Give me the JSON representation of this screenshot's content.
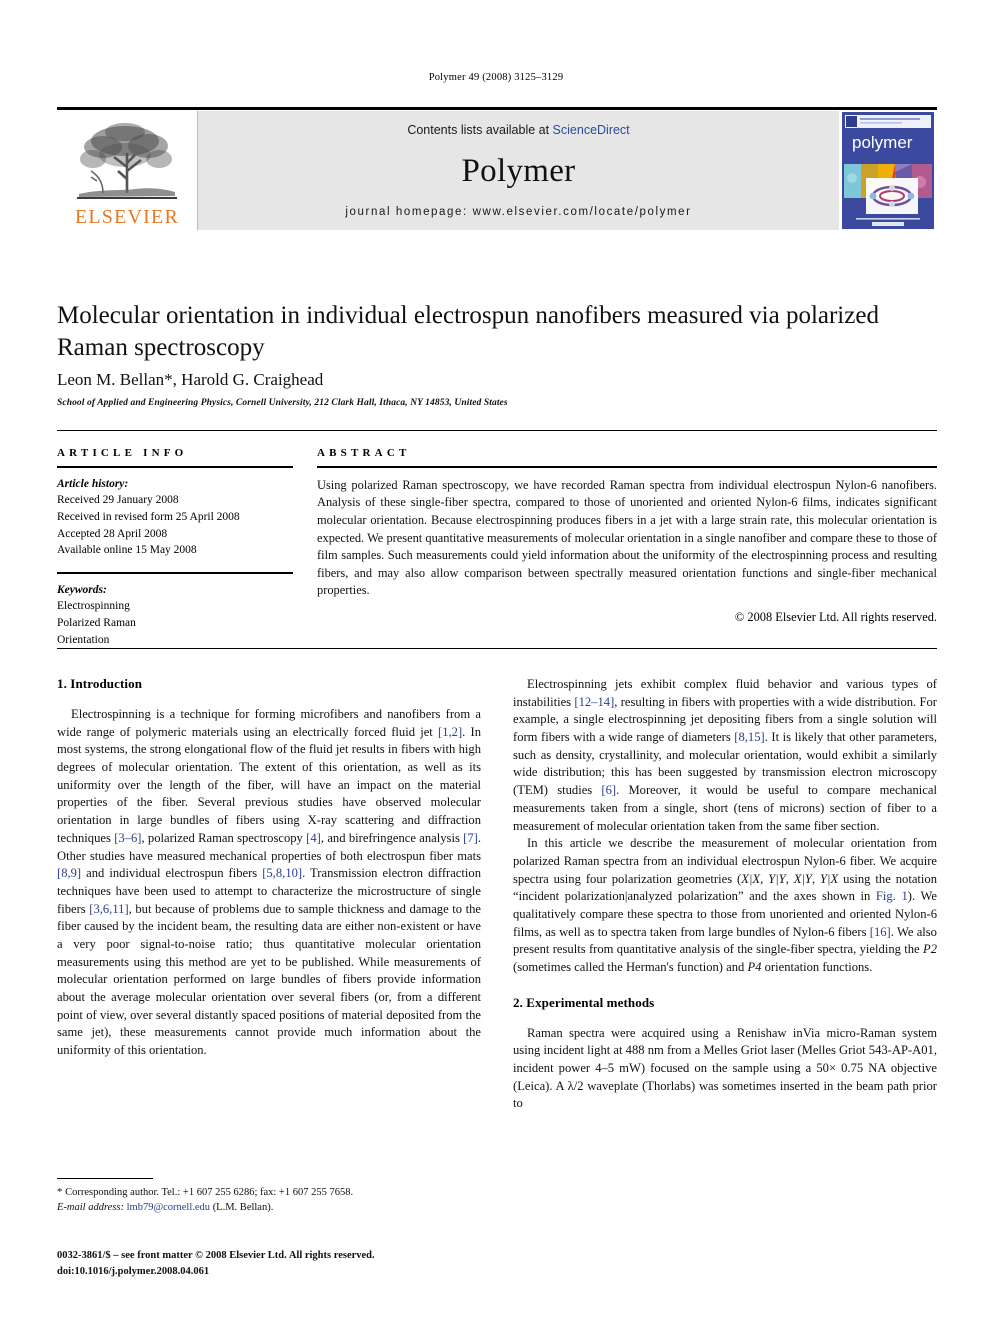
{
  "running_head": "Polymer 49 (2008) 3125–3129",
  "masthead": {
    "contents_prefix": "Contents lists available at ",
    "sciencedirect": "ScienceDirect",
    "journal_name": "Polymer",
    "homepage": "journal homepage: www.elsevier.com/locate/polymer",
    "publisher": "ELSEVIER",
    "cover_title": "polymer",
    "accent_color": "#E87722",
    "link_color": "#2b4b9b",
    "cover_bg": "#3b4a9e"
  },
  "article": {
    "title": "Molecular orientation in individual electrospun nanofibers measured via polarized Raman spectroscopy",
    "authors": "Leon M. Bellan*, Harold G. Craighead",
    "affiliation": "School of Applied and Engineering Physics, Cornell University, 212 Clark Hall, Ithaca, NY 14853, United States"
  },
  "info": {
    "label": "ARTICLE INFO",
    "history_head": "Article history:",
    "history": [
      "Received 29 January 2008",
      "Received in revised form 25 April 2008",
      "Accepted 28 April 2008",
      "Available online 15 May 2008"
    ],
    "keywords_head": "Keywords:",
    "keywords": [
      "Electrospinning",
      "Polarized Raman",
      "Orientation"
    ]
  },
  "abstract": {
    "label": "ABSTRACT",
    "text": "Using polarized Raman spectroscopy, we have recorded Raman spectra from individual electrospun Nylon-6 nanofibers. Analysis of these single-fiber spectra, compared to those of unoriented and oriented Nylon-6 films, indicates significant molecular orientation. Because electrospinning produces fibers in a jet with a large strain rate, this molecular orientation is expected. We present quantitative measurements of molecular orientation in a single nanofiber and compare these to those of film samples. Such measurements could yield information about the uniformity of the electrospinning process and resulting fibers, and may also allow comparison between spectrally measured orientation functions and single-fiber mechanical properties.",
    "copyright": "© 2008 Elsevier Ltd. All rights reserved."
  },
  "sections": {
    "intro_heading": "1. Introduction",
    "intro_p1_a": "Electrospinning is a technique for forming microfibers and nanofibers from a wide range of polymeric materials using an electrically forced fluid jet ",
    "intro_p1_r1": "[1,2]",
    "intro_p1_b": ". In most systems, the strong elongational flow of the fluid jet results in fibers with high degrees of molecular orientation. The extent of this orientation, as well as its uniformity over the length of the fiber, will have an impact on the material properties of the fiber. Several previous studies have observed molecular orientation in large bundles of fibers using X-ray scattering and diffraction techniques ",
    "intro_p1_r2": "[3–6]",
    "intro_p1_c": ", polarized Raman spectroscopy ",
    "intro_p1_r3": "[4]",
    "intro_p1_d": ", and birefringence analysis ",
    "intro_p1_r4": "[7]",
    "intro_p1_e": ". Other studies have measured mechanical properties of both electrospun fiber mats ",
    "intro_p1_r5": "[8,9]",
    "intro_p1_f": " and individual electrospun fibers ",
    "intro_p1_r6": "[5,8,10]",
    "intro_p1_g": ". Transmission electron diffraction techniques have been used to attempt to characterize the microstructure of single fibers ",
    "intro_p1_r7": "[3,6,11]",
    "intro_p1_h": ", but because of problems due to sample thickness and damage to the fiber caused by the incident beam, the resulting data are either non-existent or have a very poor signal-to-noise ratio; thus quantitative molecular orientation measurements using this method are yet to be published. While measurements of molecular orientation performed on large bundles of fibers provide information about the average molecular orientation over several fibers (or, from a different point of view, over several distantly spaced positions of material deposited from the same jet), these measurements cannot provide much information about the uniformity of this orientation.",
    "intro_p2_a": "Electrospinning jets exhibit complex fluid behavior and various types of instabilities ",
    "intro_p2_r1": "[12–14]",
    "intro_p2_b": ", resulting in fibers with properties with a wide distribution. For example, a single electrospinning jet depositing fibers from a single solution will form fibers with a wide range of diameters ",
    "intro_p2_r2": "[8,15]",
    "intro_p2_c": ". It is likely that other parameters, such as density, crystallinity, and molecular orientation, would exhibit a similarly wide distribution; this has been suggested by transmission electron microscopy (TEM) studies ",
    "intro_p2_r3": "[6]",
    "intro_p2_d": ". Moreover, it would be useful to compare mechanical measurements taken from a single, short (tens of microns) section of fiber to a measurement of molecular orientation taken from the same fiber section.",
    "intro_p3_a": "In this article we describe the measurement of molecular orientation from polarized Raman spectra from an individual electrospun Nylon-6 fiber. We acquire spectra using four polarization geometries (",
    "intro_p3_geom1": "X|X",
    "intro_p3_sep1": ", ",
    "intro_p3_geom2": "Y|Y",
    "intro_p3_sep2": ", ",
    "intro_p3_geom3": "X|Y",
    "intro_p3_sep3": ", ",
    "intro_p3_geom4": "Y|X",
    "intro_p3_b": " using the notation “incident polarization|analyzed polarization” and the axes shown in ",
    "intro_p3_figref": "Fig. 1",
    "intro_p3_c": "). We qualitatively compare these spectra to those from unoriented and oriented Nylon-6 films, as well as to spectra taken from large bundles of Nylon-6 fibers ",
    "intro_p3_r1": "[16]",
    "intro_p3_d": ". We also present results from quantitative analysis of the single-fiber spectra, yielding the ",
    "intro_p3_p2": "P2",
    "intro_p3_e": " (sometimes called the Herman's function) and ",
    "intro_p3_p4": "P4",
    "intro_p3_f": " orientation functions.",
    "methods_heading": "2. Experimental methods",
    "methods_p1": "Raman spectra were acquired using a Renishaw inVia micro-Raman system using incident light at 488 nm from a Melles Griot laser (Melles Griot 543-AP-A01, incident power 4–5 mW) focused on the sample using a 50× 0.75 NA objective (Leica). A λ/2 waveplate (Thorlabs) was sometimes inserted in the beam path prior to"
  },
  "footnote": {
    "star": "*",
    "corresponding": " Corresponding author. Tel.: +1 607 255 6286; fax: +1 607 255 7658.",
    "email_label": "E-mail address:",
    "email": "lmb79@cornell.edu",
    "email_owner": "(L.M. Bellan)."
  },
  "footer": {
    "issn_line": "0032-3861/$ – see front matter © 2008 Elsevier Ltd. All rights reserved.",
    "doi_line": "doi:10.1016/j.polymer.2008.04.061"
  }
}
